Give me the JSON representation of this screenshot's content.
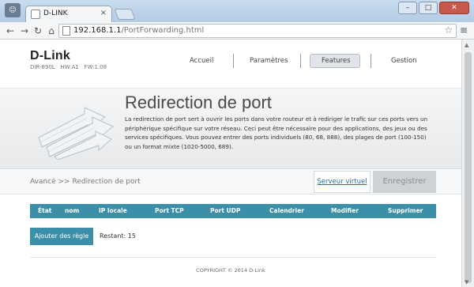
{
  "browser": {
    "tab_title": "D-LINK",
    "tab_close": "×",
    "url_host": "192.168.1.1",
    "url_path": "/PortForwarding.html",
    "win_minimize": "–",
    "win_maximize": "□",
    "win_close": "✕"
  },
  "header": {
    "logo": "D-Link",
    "model": "DIR-890L   HW:A1   FW:1.08",
    "nav": [
      "Accueil",
      "Paramètres",
      "Features",
      "Gestion"
    ],
    "active_nav": "Features"
  },
  "banner": {
    "title": "Redirection de port",
    "description": "La redirection de port sert à ouvrir les ports dans votre routeur et à rediriger le trafic sur ces ports vers un périphérique spécifique sur votre réseau. Ceci peut être nécessaire pour des applications, des jeux ou des services spécifiques. Vous pouvez entrer des ports individuels (80, 68, 888), des plages de port (100-150) ou un format mixte (1020-5000, 689)."
  },
  "toolbar": {
    "breadcrumb": "Avancé >> Redirection de port",
    "virtual_server": "Serveur virtuel",
    "save": "Enregistrer"
  },
  "table": {
    "columns": [
      "État",
      "nom",
      "IP locale",
      "Port TCP",
      "Port UDP",
      "Calendrier",
      "Modifier",
      "Supprimer"
    ]
  },
  "actions": {
    "add_rule": "Ajouter des règle",
    "remaining": "Restant: 15"
  },
  "footer": {
    "copyright": "COPYRIGHT © 2014 D-Link"
  },
  "colors": {
    "accent": "#3c8fa8",
    "link": "#2b6aa8"
  }
}
